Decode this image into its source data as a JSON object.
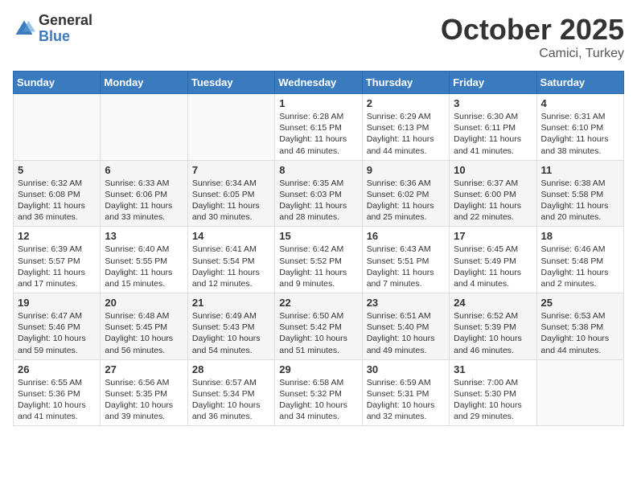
{
  "header": {
    "logo": {
      "general": "General",
      "blue": "Blue"
    },
    "title": "October 2025",
    "location": "Camici, Turkey"
  },
  "calendar": {
    "weekdays": [
      "Sunday",
      "Monday",
      "Tuesday",
      "Wednesday",
      "Thursday",
      "Friday",
      "Saturday"
    ],
    "weeks": [
      [
        {
          "day": "",
          "content": ""
        },
        {
          "day": "",
          "content": ""
        },
        {
          "day": "",
          "content": ""
        },
        {
          "day": "1",
          "content": "Sunrise: 6:28 AM\nSunset: 6:15 PM\nDaylight: 11 hours and 46 minutes."
        },
        {
          "day": "2",
          "content": "Sunrise: 6:29 AM\nSunset: 6:13 PM\nDaylight: 11 hours and 44 minutes."
        },
        {
          "day": "3",
          "content": "Sunrise: 6:30 AM\nSunset: 6:11 PM\nDaylight: 11 hours and 41 minutes."
        },
        {
          "day": "4",
          "content": "Sunrise: 6:31 AM\nSunset: 6:10 PM\nDaylight: 11 hours and 38 minutes."
        }
      ],
      [
        {
          "day": "5",
          "content": "Sunrise: 6:32 AM\nSunset: 6:08 PM\nDaylight: 11 hours and 36 minutes."
        },
        {
          "day": "6",
          "content": "Sunrise: 6:33 AM\nSunset: 6:06 PM\nDaylight: 11 hours and 33 minutes."
        },
        {
          "day": "7",
          "content": "Sunrise: 6:34 AM\nSunset: 6:05 PM\nDaylight: 11 hours and 30 minutes."
        },
        {
          "day": "8",
          "content": "Sunrise: 6:35 AM\nSunset: 6:03 PM\nDaylight: 11 hours and 28 minutes."
        },
        {
          "day": "9",
          "content": "Sunrise: 6:36 AM\nSunset: 6:02 PM\nDaylight: 11 hours and 25 minutes."
        },
        {
          "day": "10",
          "content": "Sunrise: 6:37 AM\nSunset: 6:00 PM\nDaylight: 11 hours and 22 minutes."
        },
        {
          "day": "11",
          "content": "Sunrise: 6:38 AM\nSunset: 5:58 PM\nDaylight: 11 hours and 20 minutes."
        }
      ],
      [
        {
          "day": "12",
          "content": "Sunrise: 6:39 AM\nSunset: 5:57 PM\nDaylight: 11 hours and 17 minutes."
        },
        {
          "day": "13",
          "content": "Sunrise: 6:40 AM\nSunset: 5:55 PM\nDaylight: 11 hours and 15 minutes."
        },
        {
          "day": "14",
          "content": "Sunrise: 6:41 AM\nSunset: 5:54 PM\nDaylight: 11 hours and 12 minutes."
        },
        {
          "day": "15",
          "content": "Sunrise: 6:42 AM\nSunset: 5:52 PM\nDaylight: 11 hours and 9 minutes."
        },
        {
          "day": "16",
          "content": "Sunrise: 6:43 AM\nSunset: 5:51 PM\nDaylight: 11 hours and 7 minutes."
        },
        {
          "day": "17",
          "content": "Sunrise: 6:45 AM\nSunset: 5:49 PM\nDaylight: 11 hours and 4 minutes."
        },
        {
          "day": "18",
          "content": "Sunrise: 6:46 AM\nSunset: 5:48 PM\nDaylight: 11 hours and 2 minutes."
        }
      ],
      [
        {
          "day": "19",
          "content": "Sunrise: 6:47 AM\nSunset: 5:46 PM\nDaylight: 10 hours and 59 minutes."
        },
        {
          "day": "20",
          "content": "Sunrise: 6:48 AM\nSunset: 5:45 PM\nDaylight: 10 hours and 56 minutes."
        },
        {
          "day": "21",
          "content": "Sunrise: 6:49 AM\nSunset: 5:43 PM\nDaylight: 10 hours and 54 minutes."
        },
        {
          "day": "22",
          "content": "Sunrise: 6:50 AM\nSunset: 5:42 PM\nDaylight: 10 hours and 51 minutes."
        },
        {
          "day": "23",
          "content": "Sunrise: 6:51 AM\nSunset: 5:40 PM\nDaylight: 10 hours and 49 minutes."
        },
        {
          "day": "24",
          "content": "Sunrise: 6:52 AM\nSunset: 5:39 PM\nDaylight: 10 hours and 46 minutes."
        },
        {
          "day": "25",
          "content": "Sunrise: 6:53 AM\nSunset: 5:38 PM\nDaylight: 10 hours and 44 minutes."
        }
      ],
      [
        {
          "day": "26",
          "content": "Sunrise: 6:55 AM\nSunset: 5:36 PM\nDaylight: 10 hours and 41 minutes."
        },
        {
          "day": "27",
          "content": "Sunrise: 6:56 AM\nSunset: 5:35 PM\nDaylight: 10 hours and 39 minutes."
        },
        {
          "day": "28",
          "content": "Sunrise: 6:57 AM\nSunset: 5:34 PM\nDaylight: 10 hours and 36 minutes."
        },
        {
          "day": "29",
          "content": "Sunrise: 6:58 AM\nSunset: 5:32 PM\nDaylight: 10 hours and 34 minutes."
        },
        {
          "day": "30",
          "content": "Sunrise: 6:59 AM\nSunset: 5:31 PM\nDaylight: 10 hours and 32 minutes."
        },
        {
          "day": "31",
          "content": "Sunrise: 7:00 AM\nSunset: 5:30 PM\nDaylight: 10 hours and 29 minutes."
        },
        {
          "day": "",
          "content": ""
        }
      ]
    ]
  }
}
